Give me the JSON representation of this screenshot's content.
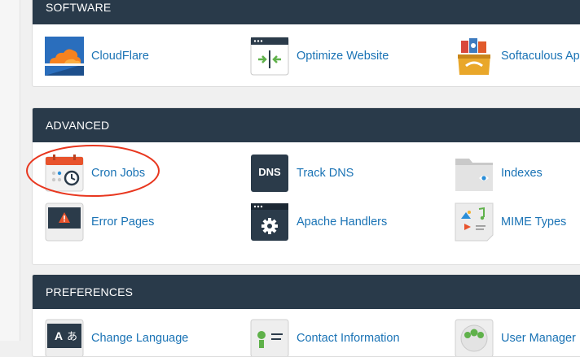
{
  "sections": {
    "software": {
      "title": "SOFTWARE",
      "items": [
        {
          "label": "CloudFlare",
          "icon": "cloudflare-icon"
        },
        {
          "label": "Optimize Website",
          "icon": "optimize-website-icon"
        },
        {
          "label": "Softaculous Ap",
          "icon": "softaculous-icon"
        }
      ]
    },
    "advanced": {
      "title": "ADVANCED",
      "items": [
        {
          "label": "Cron Jobs",
          "icon": "cron-jobs-icon"
        },
        {
          "label": "Track DNS",
          "icon": "track-dns-icon"
        },
        {
          "label": "Indexes",
          "icon": "indexes-folder-icon"
        },
        {
          "label": "Error Pages",
          "icon": "error-pages-icon"
        },
        {
          "label": "Apache Handlers",
          "icon": "apache-handlers-icon"
        },
        {
          "label": "MIME Types",
          "icon": "mime-types-icon"
        }
      ],
      "dns_text": "DNS"
    },
    "preferences": {
      "title": "PREFERENCES",
      "items": [
        {
          "label": "Change Language",
          "icon": "change-language-icon"
        },
        {
          "label": "Contact Information",
          "icon": "contact-information-icon"
        },
        {
          "label": "User Manager",
          "icon": "user-manager-icon"
        }
      ]
    }
  },
  "colors": {
    "header_bg": "#293a4a",
    "link": "#1a73b5",
    "annotation": "#e8371f"
  }
}
